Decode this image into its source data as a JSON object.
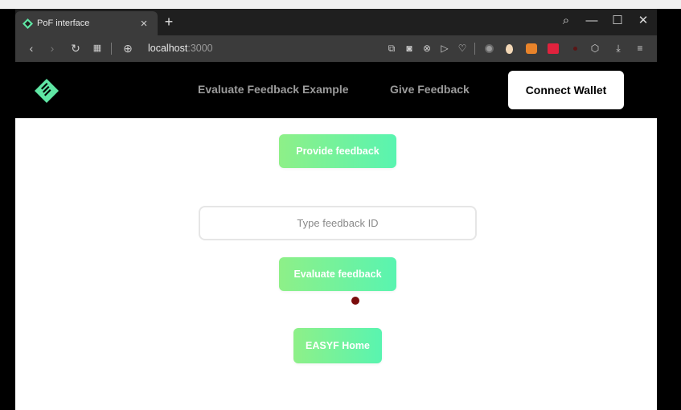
{
  "browser": {
    "tab_title": "PoF interface",
    "tab_close": "×",
    "new_tab": "+",
    "address_host": "localhost",
    "address_port": ":3000",
    "window_controls": {
      "search": "⌕",
      "minimize": "—",
      "maximize": "☐",
      "close": "✕"
    },
    "toolbar_icons": [
      "back-icon",
      "forward-icon",
      "reload-icon",
      "apps-icon",
      "globe-icon",
      "share-icon",
      "screenshot-icon",
      "shield-icon",
      "play-icon",
      "heart-icon",
      "extension-icons",
      "download-icon",
      "menu-icon"
    ]
  },
  "nav": {
    "links": [
      "Evaluate Feedback Example",
      "Give Feedback"
    ],
    "connect_wallet": "Connect Wallet"
  },
  "main": {
    "provide_button": "Provide feedback",
    "feedback_id_placeholder": "Type feedback ID",
    "evaluate_button": "Evaluate feedback",
    "home_button": "EASYF Home"
  },
  "colors": {
    "button_gradient_start": "#8ef088",
    "button_gradient_end": "#59f4b0",
    "logo": "#5fe6a4",
    "nav_bg": "#000000"
  }
}
